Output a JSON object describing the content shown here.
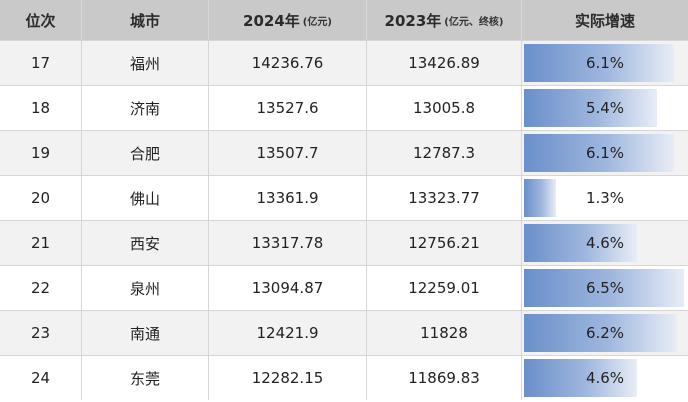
{
  "header": {
    "rank": "位次",
    "city": "城市",
    "y2024": "2024年",
    "y2024_note": "(亿元)",
    "y2023": "2023年",
    "y2023_note": "(亿元、终核)",
    "growth": "实际增速"
  },
  "rows": [
    {
      "rank": "17",
      "city": "福州",
      "v2024": "14236.76",
      "v2023": "13426.89",
      "growth": "6.1%",
      "growth_value": 6.1
    },
    {
      "rank": "18",
      "city": "济南",
      "v2024": "13527.6",
      "v2023": "13005.8",
      "growth": "5.4%",
      "growth_value": 5.4
    },
    {
      "rank": "19",
      "city": "合肥",
      "v2024": "13507.7",
      "v2023": "12787.3",
      "growth": "6.1%",
      "growth_value": 6.1
    },
    {
      "rank": "20",
      "city": "佛山",
      "v2024": "13361.9",
      "v2023": "13323.77",
      "growth": "1.3%",
      "growth_value": 1.3
    },
    {
      "rank": "21",
      "city": "西安",
      "v2024": "13317.78",
      "v2023": "12756.21",
      "growth": "4.6%",
      "growth_value": 4.6
    },
    {
      "rank": "22",
      "city": "泉州",
      "v2024": "13094.87",
      "v2023": "12259.01",
      "growth": "6.5%",
      "growth_value": 6.5
    },
    {
      "rank": "23",
      "city": "南通",
      "v2024": "12421.9",
      "v2023": "11828",
      "growth": "6.2%",
      "growth_value": 6.2
    },
    {
      "rank": "24",
      "city": "东莞",
      "v2024": "12282.15",
      "v2023": "11869.83",
      "growth": "4.6%",
      "growth_value": 4.6
    }
  ],
  "colors": {
    "header_bg": "#c9c9c9",
    "bar_start": "#6a8fca",
    "bar_end": "#e8edf6"
  }
}
